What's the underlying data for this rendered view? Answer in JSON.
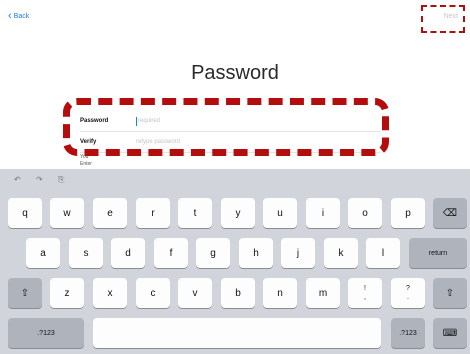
{
  "nav": {
    "back": "Back",
    "next": "Next"
  },
  "title": "Password",
  "form": {
    "password_label": "Password",
    "password_placeholder": "required",
    "verify_label": "Verify",
    "verify_placeholder": "retype password"
  },
  "note_fragments": [
    "You",
    "Enter"
  ],
  "keyboard": {
    "toolbar": [
      "↶",
      "↷",
      "⎘"
    ],
    "row1": [
      "q",
      "w",
      "e",
      "r",
      "t",
      "y",
      "u",
      "i",
      "o",
      "p"
    ],
    "row2": [
      "a",
      "s",
      "d",
      "f",
      "g",
      "h",
      "j",
      "k",
      "l"
    ],
    "row3": [
      "z",
      "x",
      "c",
      "v",
      "b",
      "n",
      "m",
      "!",
      ",",
      "?",
      "."
    ],
    "delete": "⌫",
    "return": "return",
    "shift": "⇧",
    "numbers": ".?123",
    "dismiss": "⌨"
  },
  "colors": {
    "accent": "#1a7cf5",
    "highlight": "#b30d0d",
    "keyboard_bg": "#d1d4da"
  }
}
